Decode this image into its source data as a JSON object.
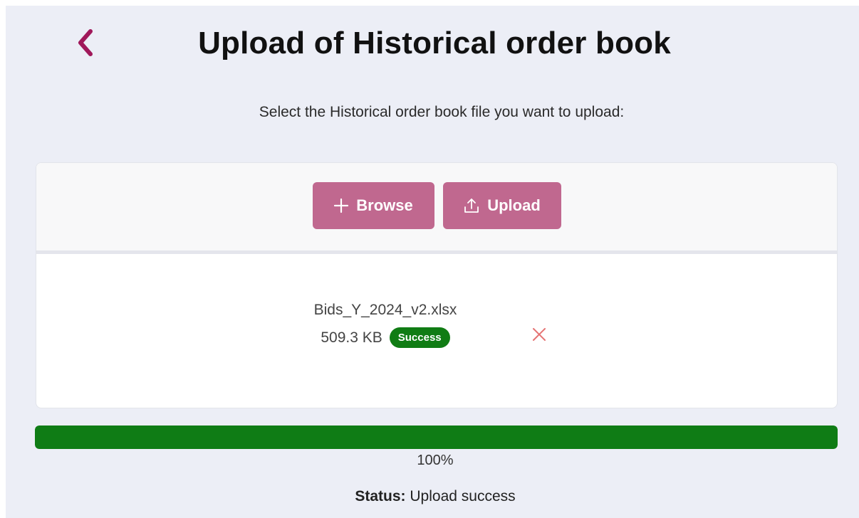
{
  "header": {
    "title": "Upload of Historical order book",
    "back_icon": "chevron-left-icon"
  },
  "instructions": "Select the Historical order book file you want to upload:",
  "toolbar": {
    "browse_label": "Browse",
    "browse_icon": "plus-icon",
    "upload_label": "Upload",
    "upload_icon": "upload-icon"
  },
  "file": {
    "name": "Bids_Y_2024_v2.xlsx",
    "size": "509.3 KB",
    "status_badge": "Success",
    "remove_icon": "close-icon"
  },
  "progress": {
    "value": 100,
    "label": "100%"
  },
  "status": {
    "label": "Status:",
    "value": "Upload success"
  },
  "colors": {
    "accent": "#a0185a",
    "button": "#c0688f",
    "success": "#107c14",
    "background": "#eceef6",
    "remove": "#e57373"
  }
}
